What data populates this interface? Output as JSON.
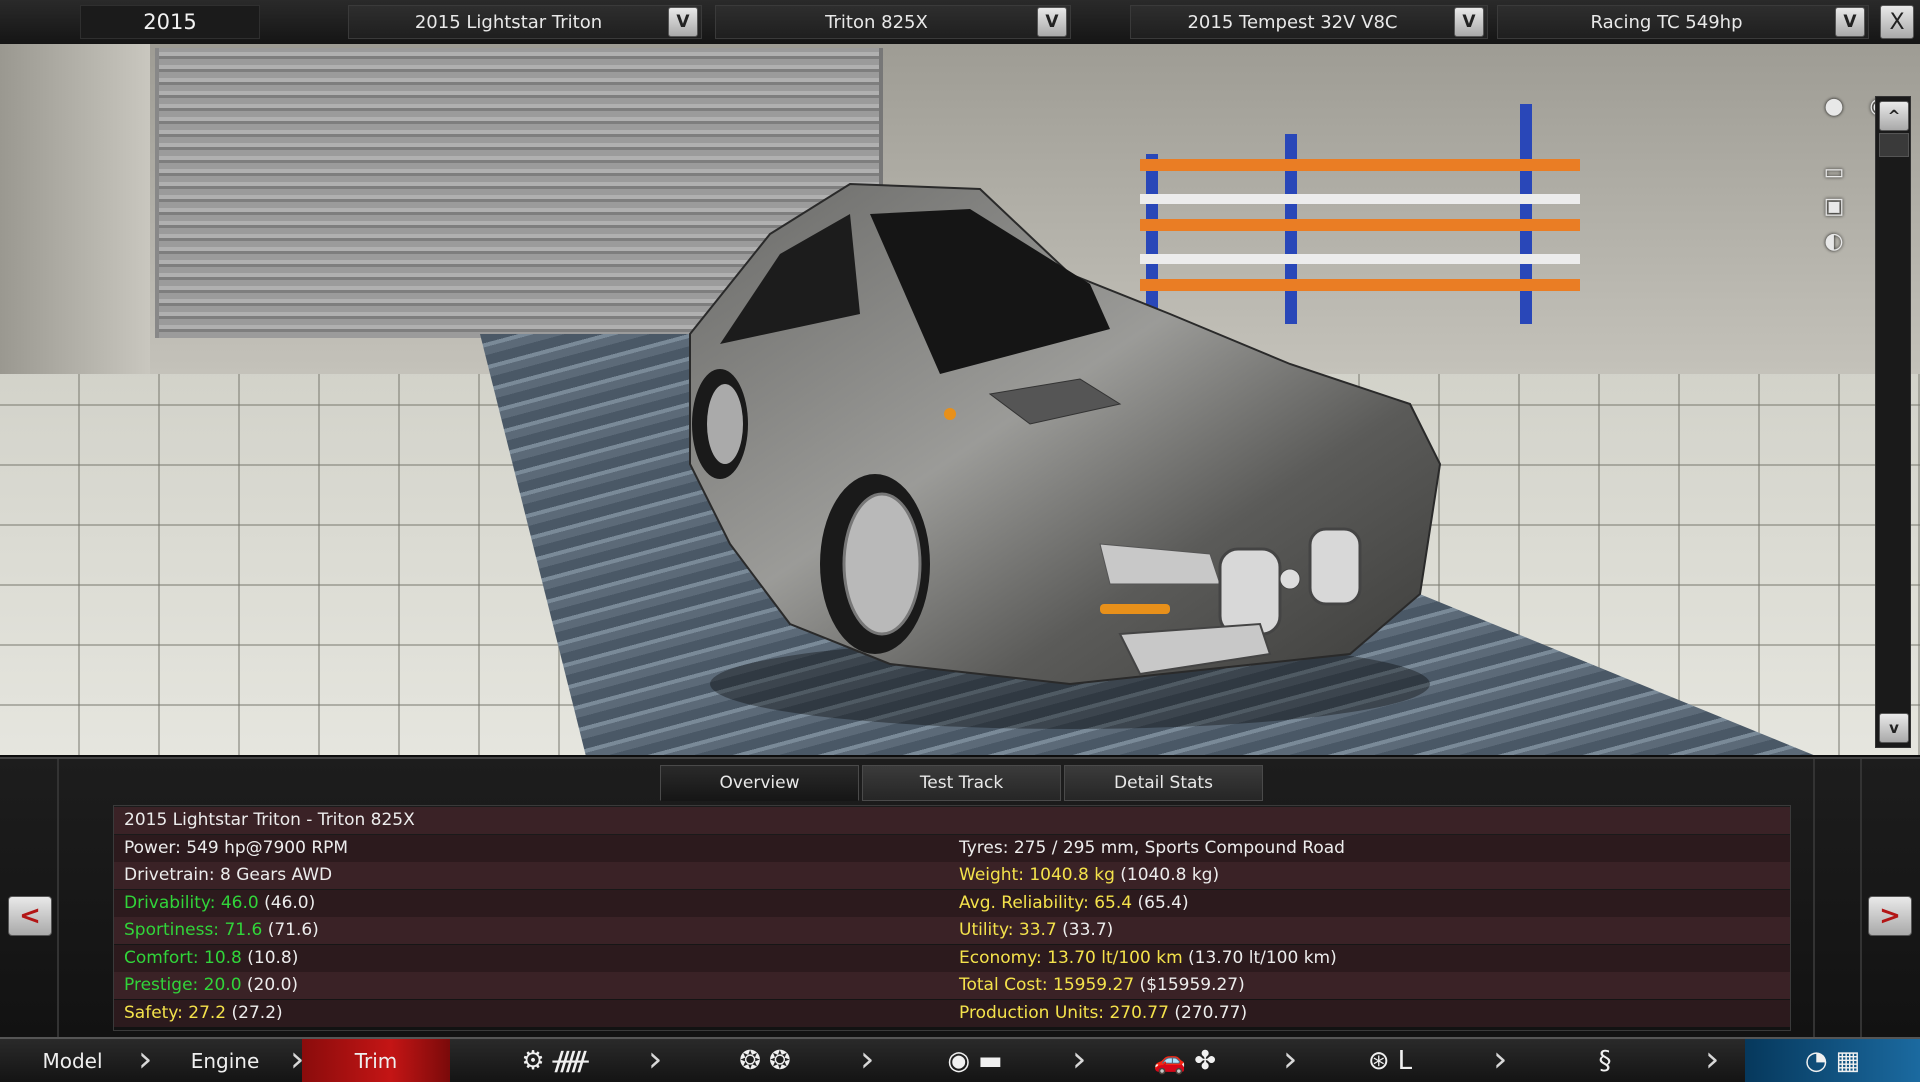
{
  "top": {
    "year": "2015",
    "selectors": [
      {
        "label": "2015 Lightstar Triton",
        "dd": "V"
      },
      {
        "label": "Triton 825X",
        "dd": "V"
      },
      {
        "label": "2015 Tempest 32V V8C",
        "dd": "V"
      },
      {
        "label": "Racing TC 549hp",
        "dd": "V"
      }
    ],
    "close": "X"
  },
  "viewport": {
    "scroll_up": "^",
    "scroll_down": "v",
    "view_icons": [
      "camera-icon",
      "eye-icon",
      "car-side-view-icon",
      "car-front-view-icon",
      "car-top-view-icon"
    ]
  },
  "tabs": [
    {
      "label": "Overview"
    },
    {
      "label": "Test Track"
    },
    {
      "label": "Detail Stats"
    }
  ],
  "nav_arrows": {
    "left": "<",
    "right": ">"
  },
  "stats": {
    "rows": [
      {
        "left": "2015 Lightstar Triton - Triton 825X",
        "left_color": "white",
        "right": "",
        "right_color": "white"
      },
      {
        "left": "Power: 549 hp@7900 RPM",
        "left_color": "white",
        "right": "Tyres: 275 / 295 mm, Sports Compound Road",
        "right_color": "white"
      },
      {
        "left": "Drivetrain: 8 Gears AWD",
        "left_color": "white",
        "right": "Weight: 1040.8 kg",
        "right_extra": " (1040.8 kg)",
        "right_color": "yellow"
      },
      {
        "left": "Drivability: 46.0",
        "left_extra": " (46.0)",
        "left_color": "green",
        "right": "Avg. Reliability: 65.4",
        "right_extra": " (65.4)",
        "right_color": "yellow"
      },
      {
        "left": "Sportiness: 71.6",
        "left_extra": " (71.6)",
        "left_color": "green",
        "right": "Utility: 33.7",
        "right_extra": " (33.7)",
        "right_color": "yellow"
      },
      {
        "left": "Comfort: 10.8",
        "left_extra": " (10.8)",
        "left_color": "green",
        "right": "Economy: 13.70 lt/100 km",
        "right_extra": " (13.70 lt/100 km)",
        "right_color": "yellow"
      },
      {
        "left": "Prestige: 20.0",
        "left_extra": " (20.0)",
        "left_color": "green",
        "right": "Total Cost: 15959.27",
        "right_extra": " ($15959.27)",
        "right_color": "yellow"
      },
      {
        "left": "Safety: 27.2",
        "left_extra": " (27.2)",
        "left_color": "yellow",
        "right": "Production Units: 270.77",
        "right_extra": " (270.77)",
        "right_color": "yellow"
      }
    ]
  },
  "bottom_nav": {
    "items": [
      {
        "label": "Model",
        "state": "normal"
      },
      {
        "label": "Engine",
        "state": "normal"
      },
      {
        "label": "Trim",
        "state": "active"
      }
    ],
    "icon_groups": [
      [
        "gear-icon",
        "gearbox-icon"
      ],
      [
        "wheel-icon",
        "wheel-icon"
      ],
      [
        "brake-icon",
        "chassis-icon"
      ],
      [
        "car-body-icon",
        "fan-icon"
      ],
      [
        "steering-wheel-icon",
        "seat-icon"
      ],
      [
        "spring-icon"
      ],
      [
        "speed-gauge-icon",
        "checkered-flag-icon"
      ]
    ]
  },
  "colors": {
    "green": "#31d43a",
    "yellow": "#f4e24b",
    "accent_red": "#c41515",
    "row_odd": "#3a2226",
    "row_even": "#2c1a1d"
  }
}
